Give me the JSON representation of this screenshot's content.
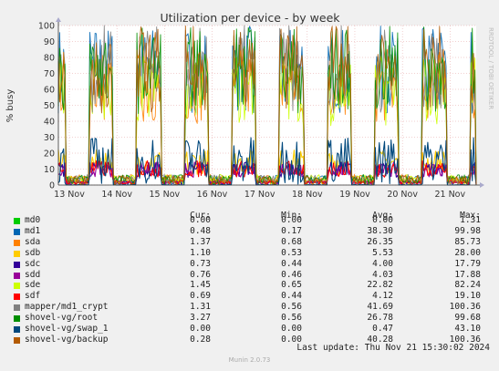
{
  "chart_data": {
    "type": "line",
    "title": "Utilization per device - by week",
    "ylabel": "% busy",
    "ylim": [
      0,
      100
    ],
    "yticks": [
      0,
      10,
      20,
      30,
      40,
      50,
      60,
      70,
      80,
      90,
      100
    ],
    "x_labels": [
      "13 Nov",
      "14 Nov",
      "15 Nov",
      "16 Nov",
      "17 Nov",
      "18 Nov",
      "19 Nov",
      "20 Nov",
      "21 Nov"
    ],
    "watermark": "RRDTOOL / TOBI OETIKER",
    "series": [
      {
        "name": "md0",
        "color": "#00cc00",
        "cur": "0.00",
        "min": "0.00",
        "avg": "0.00",
        "max": "1.31"
      },
      {
        "name": "md1",
        "color": "#0066b3",
        "cur": "0.48",
        "min": "0.17",
        "avg": "38.30",
        "max": "99.98"
      },
      {
        "name": "sda",
        "color": "#ff8000",
        "cur": "1.37",
        "min": "0.68",
        "avg": "26.35",
        "max": "85.73"
      },
      {
        "name": "sdb",
        "color": "#ffcc00",
        "cur": "1.10",
        "min": "0.53",
        "avg": "5.53",
        "max": "28.00"
      },
      {
        "name": "sdc",
        "color": "#330099",
        "cur": "0.73",
        "min": "0.44",
        "avg": "4.00",
        "max": "17.79"
      },
      {
        "name": "sdd",
        "color": "#990099",
        "cur": "0.76",
        "min": "0.46",
        "avg": "4.03",
        "max": "17.88"
      },
      {
        "name": "sde",
        "color": "#ccff00",
        "cur": "1.45",
        "min": "0.65",
        "avg": "22.82",
        "max": "82.24"
      },
      {
        "name": "sdf",
        "color": "#ff0000",
        "cur": "0.69",
        "min": "0.44",
        "avg": "4.12",
        "max": "19.10"
      },
      {
        "name": "mapper/md1_crypt",
        "color": "#808080",
        "cur": "1.31",
        "min": "0.56",
        "avg": "41.69",
        "max": "100.36"
      },
      {
        "name": "shovel-vg/root",
        "color": "#008f00",
        "cur": "3.27",
        "min": "0.56",
        "avg": "26.78",
        "max": "99.68"
      },
      {
        "name": "shovel-vg/swap_1",
        "color": "#00487d",
        "cur": "0.00",
        "min": "0.00",
        "avg": "0.47",
        "max": "43.10"
      },
      {
        "name": "shovel-vg/backup",
        "color": "#b35a00",
        "cur": "0.28",
        "min": "0.00",
        "avg": "40.28",
        "max": "100.36"
      }
    ],
    "legend_headers": {
      "cur": "Cur:",
      "min": "Min:",
      "avg": "Avg:",
      "max": "Max:"
    }
  },
  "footer": {
    "last_update": "Last update: Thu Nov 21 15:30:02 2024",
    "munin_version": "Munin 2.0.73"
  }
}
